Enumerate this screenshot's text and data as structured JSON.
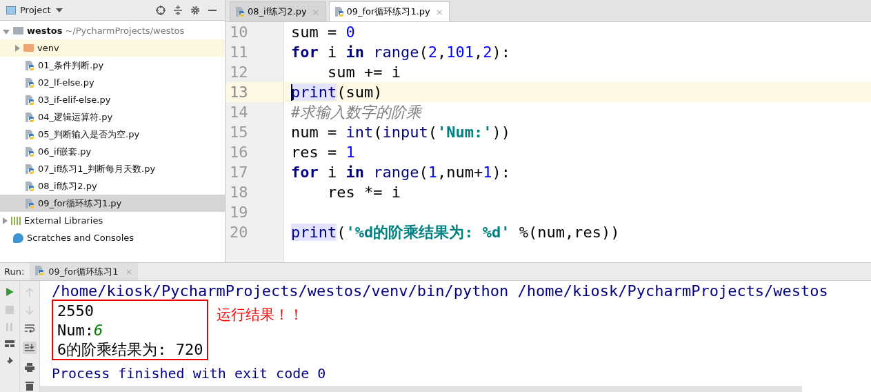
{
  "project_panel": {
    "title": "Project",
    "tree": [
      {
        "label": "westos",
        "path": "~/PycharmProjects/westos",
        "kind": "root",
        "expanded": true,
        "selected": false,
        "children": [
          {
            "label": "venv",
            "kind": "folder",
            "expanded": false,
            "selected": false,
            "highlighted": true
          },
          {
            "label": "01_条件判断.py",
            "kind": "file",
            "selected": false
          },
          {
            "label": "02_lf-else.py",
            "kind": "file",
            "selected": false
          },
          {
            "label": "03_if-elif-else.py",
            "kind": "file",
            "selected": false
          },
          {
            "label": "04_逻辑运算符.py",
            "kind": "file",
            "selected": false
          },
          {
            "label": "05_判断输入是否为空.py",
            "kind": "file",
            "selected": false
          },
          {
            "label": "06_if嵌套.py",
            "kind": "file",
            "selected": false
          },
          {
            "label": "07_if练习1_判断每月天数.py",
            "kind": "file",
            "selected": false
          },
          {
            "label": "08_if练习2.py",
            "kind": "file",
            "selected": false
          },
          {
            "label": "09_for循环练习1.py",
            "kind": "file",
            "selected": true
          }
        ]
      },
      {
        "label": "External Libraries",
        "kind": "libraries",
        "expanded": false,
        "selected": false
      },
      {
        "label": "Scratches and Consoles",
        "kind": "scratches",
        "selected": false
      }
    ]
  },
  "editor": {
    "tabs": [
      {
        "label": "08_if练习2.py",
        "close": "×",
        "selected": false
      },
      {
        "label": "09_for循环练习1.py",
        "close": "×",
        "selected": true
      }
    ],
    "lines": [
      {
        "number": "10",
        "current": false,
        "tokens": [
          {
            "text": "sum = ",
            "kind": "plain"
          },
          {
            "text": "0",
            "kind": "num"
          }
        ]
      },
      {
        "number": "11",
        "current": false,
        "tokens": [
          {
            "text": "for",
            "kind": "kw"
          },
          {
            "text": " i ",
            "kind": "plain"
          },
          {
            "text": "in",
            "kind": "kw"
          },
          {
            "text": " range",
            "kind": "builtin"
          },
          {
            "text": "(",
            "kind": "plain"
          },
          {
            "text": "2",
            "kind": "num"
          },
          {
            "text": ",",
            "kind": "plain"
          },
          {
            "text": "101",
            "kind": "num"
          },
          {
            "text": ",",
            "kind": "plain"
          },
          {
            "text": "2",
            "kind": "num"
          },
          {
            "text": "):",
            "kind": "plain"
          }
        ]
      },
      {
        "number": "12",
        "current": false,
        "tokens": [
          {
            "text": "    sum += i",
            "kind": "plain"
          }
        ]
      },
      {
        "number": "13",
        "current": true,
        "tokens": [
          {
            "text": "print",
            "kind": "marked"
          },
          {
            "text": "(sum)",
            "kind": "plain"
          }
        ]
      },
      {
        "number": "14",
        "current": false,
        "tokens": [
          {
            "text": "#求输入数字的阶乘",
            "kind": "comment"
          }
        ]
      },
      {
        "number": "15",
        "current": false,
        "tokens": [
          {
            "text": "num = ",
            "kind": "plain"
          },
          {
            "text": "int",
            "kind": "builtin"
          },
          {
            "text": "(",
            "kind": "plain"
          },
          {
            "text": "input",
            "kind": "builtin"
          },
          {
            "text": "(",
            "kind": "plain"
          },
          {
            "text": "'Num:'",
            "kind": "str"
          },
          {
            "text": "))",
            "kind": "plain"
          }
        ]
      },
      {
        "number": "16",
        "current": false,
        "tokens": [
          {
            "text": "res = ",
            "kind": "plain"
          },
          {
            "text": "1",
            "kind": "num"
          }
        ]
      },
      {
        "number": "17",
        "current": false,
        "tokens": [
          {
            "text": "for",
            "kind": "kw"
          },
          {
            "text": " i ",
            "kind": "plain"
          },
          {
            "text": "in",
            "kind": "kw"
          },
          {
            "text": " range",
            "kind": "builtin"
          },
          {
            "text": "(",
            "kind": "plain"
          },
          {
            "text": "1",
            "kind": "num"
          },
          {
            "text": ",num+",
            "kind": "plain"
          },
          {
            "text": "1",
            "kind": "num"
          },
          {
            "text": "):",
            "kind": "plain"
          }
        ]
      },
      {
        "number": "18",
        "current": false,
        "tokens": [
          {
            "text": "    res *= i",
            "kind": "plain"
          }
        ]
      },
      {
        "number": "19",
        "current": false
      },
      {
        "number": "20",
        "current": false,
        "tokens": [
          {
            "text": "print",
            "kind": "marked"
          },
          {
            "text": "(",
            "kind": "plain"
          },
          {
            "text": "'%d的阶乘结果为: %d'",
            "kind": "str"
          },
          {
            "text": " %(num,res))",
            "kind": "plain"
          }
        ]
      }
    ]
  },
  "run_panel": {
    "label": "Run:",
    "tab": "09_for循环练习1",
    "tab_close": "×",
    "command": "/home/kiosk/PycharmProjects/westos/venv/bin/python /home/kiosk/PycharmProjects/westos",
    "output": [
      [
        {
          "text": "2550",
          "kind": "plain"
        }
      ],
      [
        {
          "text": "Num:",
          "kind": "plain"
        },
        {
          "text": "6",
          "kind": "input"
        }
      ],
      [
        {
          "text": "6的阶乘结果为: 720",
          "kind": "plain"
        }
      ]
    ],
    "annotation": "运行结果！！",
    "exit_message": "Process finished with exit code 0"
  }
}
